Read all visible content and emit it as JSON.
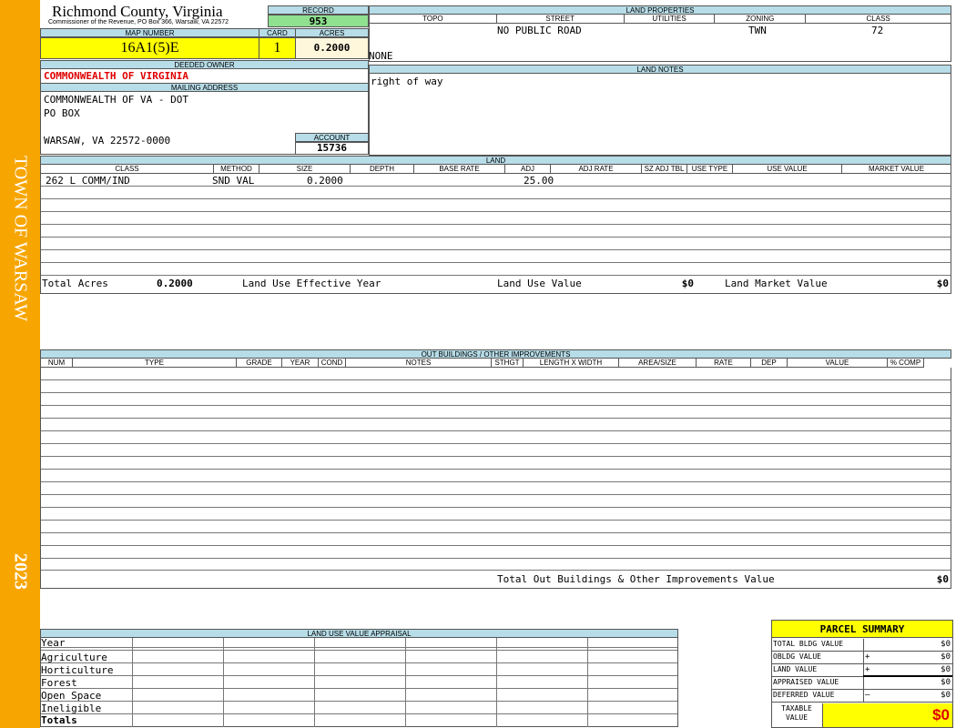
{
  "header": {
    "county": "Richmond County, Virginia",
    "commissioner": "Commissioner of the Revenue, PO Box 366, Warsaw, VA 22572"
  },
  "sidebar": {
    "town": "TOWN OF WARSAW",
    "year": "2023"
  },
  "record": {
    "label": "RECORD",
    "value": "953"
  },
  "map_number": {
    "label": "MAP NUMBER",
    "value": "16A1(5)E"
  },
  "card": {
    "label": "CARD",
    "value": "1"
  },
  "acres": {
    "label": "ACRES",
    "value": "0.2000"
  },
  "deeded_owner": {
    "label": "DEEDED OWNER",
    "value": "COMMONWEALTH OF VIRGINIA"
  },
  "mailing_address": {
    "label": "MAILING ADDRESS",
    "line1": "COMMONWEALTH OF VA - DOT",
    "line2": "PO BOX",
    "line3": "WARSAW, VA 22572-0000"
  },
  "account": {
    "label": "ACCOUNT",
    "value": "15736"
  },
  "land_properties": {
    "label": "LAND PROPERTIES",
    "columns": [
      "TOPO",
      "STREET",
      "UTILITIES",
      "ZONING",
      "CLASS"
    ],
    "street": "NO PUBLIC ROAD",
    "zoning": "TWN",
    "class": "72",
    "extra": "NONE"
  },
  "land_notes": {
    "label": "LAND NOTES",
    "text": "right of way"
  },
  "land": {
    "label": "LAND",
    "columns": [
      "CLASS",
      "METHOD",
      "SIZE",
      "DEPTH",
      "BASE RATE",
      "ADJ",
      "ADJ RATE",
      "SZ ADJ TBL",
      "USE TYPE",
      "USE VALUE",
      "MARKET VALUE"
    ],
    "row": {
      "class": "262 L COMM/IND",
      "method": "SND VAL",
      "size": "0.2000",
      "adj": "25.00"
    },
    "totals": {
      "total_acres_label": "Total Acres",
      "total_acres": "0.2000",
      "effective_year_label": "Land Use Effective Year",
      "land_use_value_label": "Land Use Value",
      "land_use_value": "$0",
      "land_market_value_label": "Land Market Value",
      "land_market_value": "$0"
    }
  },
  "outbuildings": {
    "label": "OUT BUILDINGS / OTHER IMPROVEMENTS",
    "columns": [
      "NUM",
      "TYPE",
      "GRADE",
      "YEAR",
      "COND",
      "NOTES",
      "STHGT",
      "LENGTH X WIDTH",
      "AREA/SIZE",
      "RATE",
      "DEP",
      "VALUE",
      "% COMP"
    ],
    "total_label": "Total Out Buildings & Other Improvements Value",
    "total_value": "$0"
  },
  "land_use_appraisal": {
    "label": "LAND USE VALUE APPRAISAL",
    "rows": [
      "Year",
      "Agriculture",
      "Horticulture",
      "Forest",
      "Open Space",
      "Ineligible",
      "Totals"
    ]
  },
  "parcel_summary": {
    "title": "PARCEL SUMMARY",
    "rows": [
      {
        "label": "TOTAL BLDG VALUE",
        "op": "",
        "value": "$0"
      },
      {
        "label": "OBLDG VALUE",
        "op": "+",
        "value": "$0"
      },
      {
        "label": "LAND VALUE",
        "op": "+",
        "value": "$0"
      },
      {
        "label": "APPRAISED VALUE",
        "op": "",
        "value": "$0"
      },
      {
        "label": "DEFERRED VALUE",
        "op": "–",
        "value": "$0"
      }
    ],
    "taxable_label": "TAXABLE VALUE",
    "taxable_value": "$0"
  }
}
